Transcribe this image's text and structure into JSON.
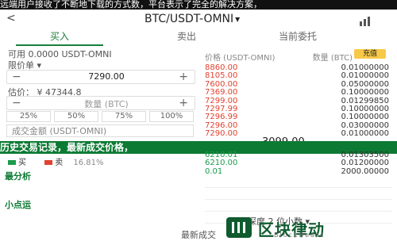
{
  "top_banner": "远端用户接收了不断地下载的方式数，平台表示了完全的解决方案，",
  "header": {
    "back": "<",
    "pair": "BTC/USDT-OMNI",
    "caret": "▾"
  },
  "tabs": [
    "买入",
    "卖出",
    "当前委托"
  ],
  "left": {
    "available": "可用 0.0000 USDT-OMNI",
    "price_label": "限价单 ▾",
    "price_value": "7290.00",
    "est_value": "估价： ¥ 47344.8",
    "amount_placeholder": "数量 (BTC)",
    "pcts": [
      "25%",
      "50%",
      "75%",
      "100%"
    ],
    "total_placeholder": "成交金额 (USDT-OMNI)"
  },
  "right": {
    "col_price": "价格 (USDT-OMNI)",
    "col_qty": "数量 (BTC)",
    "asks": [
      {
        "price": "8860.00",
        "qty": "0.01000000"
      },
      {
        "price": "8105.00",
        "qty": "0.01000000"
      },
      {
        "price": "7600.00",
        "qty": "0.05000000"
      },
      {
        "price": "7369.00",
        "qty": "0.10000000"
      },
      {
        "price": "7299.00",
        "qty": "0.01299850"
      },
      {
        "price": "7297.99",
        "qty": "0.10000000"
      },
      {
        "price": "7296.99",
        "qty": "0.10000000"
      },
      {
        "price": "7296.00",
        "qty": "0.03000000"
      },
      {
        "price": "7290.00",
        "qty": "0.01000000"
      }
    ],
    "mid_price": "3099.00",
    "bids": [
      {
        "price": "6210.01",
        "qty": "0.01303500"
      },
      {
        "price": "6210.00",
        "qty": "0.01200000"
      },
      {
        "price": "0.01",
        "qty": "2000.00000"
      }
    ],
    "button": "充值"
  },
  "mid_banner": "历史交易记录，最新成交价格，",
  "legend": {
    "buy": "买",
    "sell": "卖",
    "pct": "16.81%"
  },
  "side_labels": [
    "最分析",
    "小点运"
  ],
  "depth_label": "深度 2 位小数 ▾",
  "bottom_text": "最新成交",
  "logo": {
    "main": "区块律动",
    "sub": "BlockBeats"
  },
  "colors": {
    "buy": "#1a9c4a",
    "sell": "#e2412f",
    "brand": "#0f5b2f",
    "accent": "#f7c948"
  }
}
